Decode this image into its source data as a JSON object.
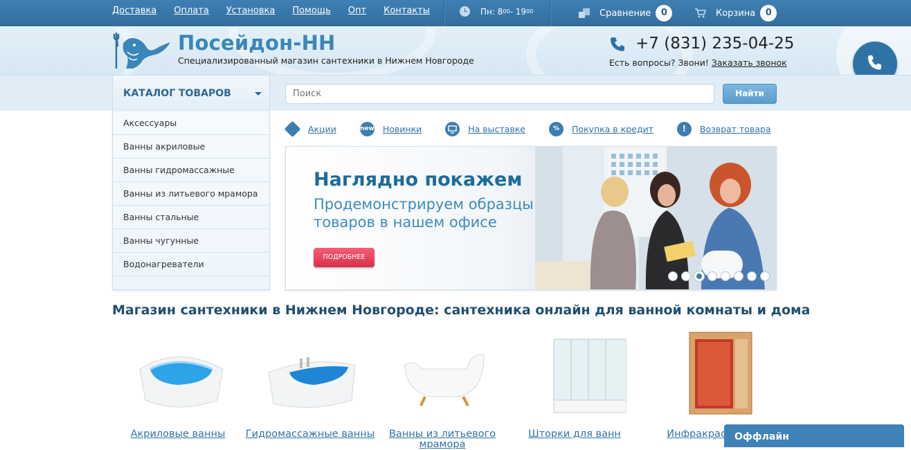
{
  "topbar": {
    "nav": [
      "Доставка",
      "Оплата",
      "Установка",
      "Помощь",
      "Опт",
      "Контакты"
    ],
    "hours_prefix": "Пн: 8",
    "hours_open_sup": "00",
    "hours_mid": " - 19",
    "hours_close_sup": "00",
    "compare_label": "Сравнение",
    "compare_count": "0",
    "cart_label": "Корзина",
    "cart_count": "0"
  },
  "header": {
    "title": "Посейдон-НН",
    "subtitle": "Специализированный магазин сантехники в Нижнем Новгороде",
    "phone": "+7 (831) 235-04-25",
    "callback_text": "Есть вопросы? Звони!",
    "callback_link": "Заказать звонок"
  },
  "catalog": {
    "button_label": "КАТАЛОГ ТОВАРОВ",
    "items": [
      "Аксессуары",
      "Ванны акриловые",
      "Ванны гидромассажные",
      "Ванны из литьевого мрамора",
      "Ванны стальные",
      "Ванны чугунные",
      "Водонагреватели"
    ]
  },
  "search": {
    "placeholder": "Поиск",
    "button": "Найти"
  },
  "quick_links": [
    {
      "label": "Акции",
      "icon": "tag-icon",
      "glyph": ""
    },
    {
      "label": "Новинки",
      "icon": "new-icon",
      "glyph": "new"
    },
    {
      "label": "На выставке",
      "icon": "display-icon",
      "glyph": ""
    },
    {
      "label": "Покупка в кредит",
      "icon": "percent-icon",
      "glyph": "%"
    },
    {
      "label": "Возврат товара",
      "icon": "exclamation-icon",
      "glyph": "!"
    }
  ],
  "banner": {
    "heading": "Наглядно покажем",
    "text": "Продемонстрируем образцы товаров в нашем офисе",
    "button": "ПОДРОБНЕЕ",
    "slides": 8,
    "active_slide": 3
  },
  "section_title": "Магазин сантехники в Нижнем Новгороде: сантехника онлайн для ванной комнаты и дома",
  "products": [
    {
      "name": "Акриловые ванны"
    },
    {
      "name": "Гидромассажные ванны"
    },
    {
      "name": "Ванны из литьевого мрамора"
    },
    {
      "name": "Шторки для ванн"
    },
    {
      "name": "Инфракрасные"
    }
  ],
  "chat": {
    "status": "Оффлайн"
  },
  "colors": {
    "brand": "#3a86b8",
    "topbar": "#3f7fb3",
    "accent_button": "#d9304a"
  }
}
